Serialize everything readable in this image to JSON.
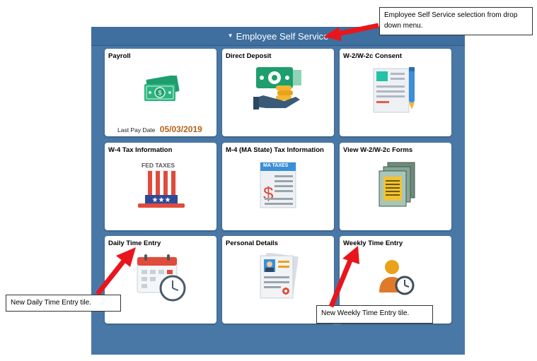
{
  "header": {
    "title": "Employee Self Service",
    "caret": "▼"
  },
  "tiles": [
    {
      "title": "Payroll",
      "icon": "money-icon",
      "last_pay_label": "Last Pay Date",
      "last_pay_date": "05/03/2019"
    },
    {
      "title": "Direct Deposit",
      "icon": "direct-deposit-icon"
    },
    {
      "title": "W-2/W-2c Consent",
      "icon": "consent-document-icon"
    },
    {
      "title": "W-4 Tax Information",
      "icon": "fed-taxes-hat-icon",
      "icon_text": "FED TAXES"
    },
    {
      "title": "M-4 (MA State) Tax Information",
      "icon": "ma-taxes-document-icon",
      "icon_text": "MA TAXES"
    },
    {
      "title": "View W-2/W-2c Forms",
      "icon": "forms-stack-icon"
    },
    {
      "title": "Daily Time Entry",
      "icon": "calendar-clock-icon"
    },
    {
      "title": "Personal Details",
      "icon": "id-document-icon"
    },
    {
      "title": "Weekly Time Entry",
      "icon": "person-clock-icon"
    }
  ],
  "annotations": {
    "ess_selection": "Employee Self Service selection from drop down menu.",
    "daily_tile": "New Daily Time Entry tile.",
    "weekly_tile": "New Weekly Time Entry tile."
  },
  "colors": {
    "panel": "#4a78a6",
    "arrow": "#e8161c",
    "date": "#b4621b"
  }
}
